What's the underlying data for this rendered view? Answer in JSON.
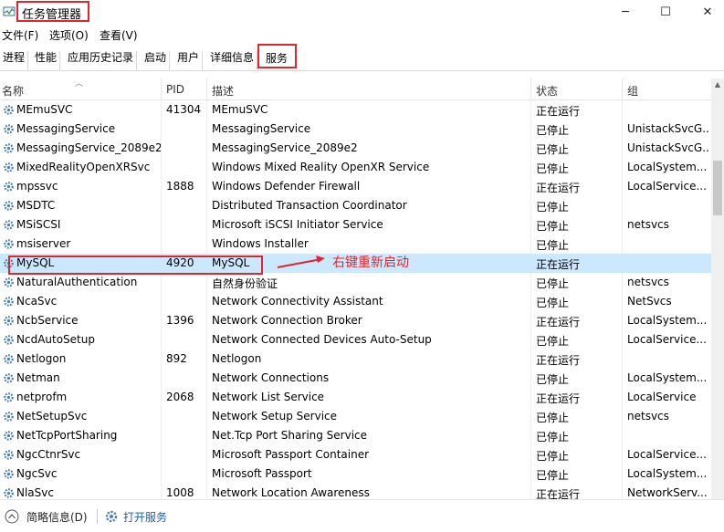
{
  "window": {
    "title": "任务管理器",
    "btn_min": "─",
    "btn_max": "☐",
    "btn_close": "✕"
  },
  "menu": [
    {
      "label": "文件(F)"
    },
    {
      "label": "选项(O)"
    },
    {
      "label": "查看(V)"
    }
  ],
  "tabs": [
    {
      "label": "进程"
    },
    {
      "label": "性能"
    },
    {
      "label": "应用历史记录"
    },
    {
      "label": "启动"
    },
    {
      "label": "用户"
    },
    {
      "label": "详细信息"
    },
    {
      "label": "服务"
    }
  ],
  "columns": {
    "name": "名称",
    "pid": "PID",
    "desc": "描述",
    "status": "状态",
    "group": "组"
  },
  "rows": [
    {
      "name": "MEmuSVC",
      "pid": "41304",
      "desc": "MEmuSVC",
      "status": "正在运行",
      "group": ""
    },
    {
      "name": "MessagingService",
      "pid": "",
      "desc": "MessagingService",
      "status": "已停止",
      "group": "UnistackSvcG..."
    },
    {
      "name": "MessagingService_2089e2",
      "pid": "",
      "desc": "MessagingService_2089e2",
      "status": "已停止",
      "group": "UnistackSvcG..."
    },
    {
      "name": "MixedRealityOpenXRSvc",
      "pid": "",
      "desc": "Windows Mixed Reality OpenXR Service",
      "status": "已停止",
      "group": "LocalSystem..."
    },
    {
      "name": "mpssvc",
      "pid": "1888",
      "desc": "Windows Defender Firewall",
      "status": "正在运行",
      "group": "LocalService..."
    },
    {
      "name": "MSDTC",
      "pid": "",
      "desc": "Distributed Transaction Coordinator",
      "status": "已停止",
      "group": ""
    },
    {
      "name": "MSiSCSI",
      "pid": "",
      "desc": "Microsoft iSCSI Initiator Service",
      "status": "已停止",
      "group": "netsvcs"
    },
    {
      "name": "msiserver",
      "pid": "",
      "desc": "Windows Installer",
      "status": "已停止",
      "group": ""
    },
    {
      "name": "MySQL",
      "pid": "4920",
      "desc": "MySQL",
      "status": "正在运行",
      "group": ""
    },
    {
      "name": "NaturalAuthentication",
      "pid": "",
      "desc": "自然身份验证",
      "status": "已停止",
      "group": "netsvcs"
    },
    {
      "name": "NcaSvc",
      "pid": "",
      "desc": "Network Connectivity Assistant",
      "status": "已停止",
      "group": "NetSvcs"
    },
    {
      "name": "NcbService",
      "pid": "1396",
      "desc": "Network Connection Broker",
      "status": "正在运行",
      "group": "LocalSystem..."
    },
    {
      "name": "NcdAutoSetup",
      "pid": "",
      "desc": "Network Connected Devices Auto-Setup",
      "status": "已停止",
      "group": "LocalService..."
    },
    {
      "name": "Netlogon",
      "pid": "892",
      "desc": "Netlogon",
      "status": "正在运行",
      "group": ""
    },
    {
      "name": "Netman",
      "pid": "",
      "desc": "Network Connections",
      "status": "已停止",
      "group": "LocalSystem..."
    },
    {
      "name": "netprofm",
      "pid": "2068",
      "desc": "Network List Service",
      "status": "正在运行",
      "group": "LocalService"
    },
    {
      "name": "NetSetupSvc",
      "pid": "",
      "desc": "Network Setup Service",
      "status": "已停止",
      "group": "netsvcs"
    },
    {
      "name": "NetTcpPortSharing",
      "pid": "",
      "desc": "Net.Tcp Port Sharing Service",
      "status": "已停止",
      "group": ""
    },
    {
      "name": "NgcCtnrSvc",
      "pid": "",
      "desc": "Microsoft Passport Container",
      "status": "已停止",
      "group": "LocalService..."
    },
    {
      "name": "NgcSvc",
      "pid": "",
      "desc": "Microsoft Passport",
      "status": "已停止",
      "group": "LocalSystem..."
    },
    {
      "name": "NlaSvc",
      "pid": "1008",
      "desc": "Network Location Awareness",
      "status": "正在运行",
      "group": "NetworkServ..."
    }
  ],
  "annotation": "右键重新启动",
  "statusbar": {
    "brief": "简略信息(D)",
    "open_services": "打开服务"
  },
  "colors": {
    "highlight": "#e0262b",
    "selected_row": "#cce8ff",
    "gear": "#4a7fb0"
  }
}
